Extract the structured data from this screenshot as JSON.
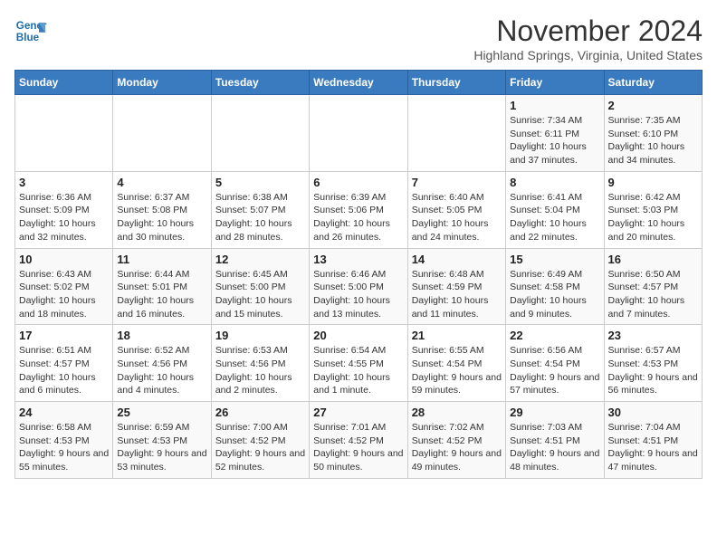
{
  "header": {
    "logo_line1": "General",
    "logo_line2": "Blue",
    "month": "November 2024",
    "location": "Highland Springs, Virginia, United States"
  },
  "days_of_week": [
    "Sunday",
    "Monday",
    "Tuesday",
    "Wednesday",
    "Thursday",
    "Friday",
    "Saturday"
  ],
  "weeks": [
    [
      {
        "day": "",
        "info": ""
      },
      {
        "day": "",
        "info": ""
      },
      {
        "day": "",
        "info": ""
      },
      {
        "day": "",
        "info": ""
      },
      {
        "day": "",
        "info": ""
      },
      {
        "day": "1",
        "info": "Sunrise: 7:34 AM\nSunset: 6:11 PM\nDaylight: 10 hours and 37 minutes."
      },
      {
        "day": "2",
        "info": "Sunrise: 7:35 AM\nSunset: 6:10 PM\nDaylight: 10 hours and 34 minutes."
      }
    ],
    [
      {
        "day": "3",
        "info": "Sunrise: 6:36 AM\nSunset: 5:09 PM\nDaylight: 10 hours and 32 minutes."
      },
      {
        "day": "4",
        "info": "Sunrise: 6:37 AM\nSunset: 5:08 PM\nDaylight: 10 hours and 30 minutes."
      },
      {
        "day": "5",
        "info": "Sunrise: 6:38 AM\nSunset: 5:07 PM\nDaylight: 10 hours and 28 minutes."
      },
      {
        "day": "6",
        "info": "Sunrise: 6:39 AM\nSunset: 5:06 PM\nDaylight: 10 hours and 26 minutes."
      },
      {
        "day": "7",
        "info": "Sunrise: 6:40 AM\nSunset: 5:05 PM\nDaylight: 10 hours and 24 minutes."
      },
      {
        "day": "8",
        "info": "Sunrise: 6:41 AM\nSunset: 5:04 PM\nDaylight: 10 hours and 22 minutes."
      },
      {
        "day": "9",
        "info": "Sunrise: 6:42 AM\nSunset: 5:03 PM\nDaylight: 10 hours and 20 minutes."
      }
    ],
    [
      {
        "day": "10",
        "info": "Sunrise: 6:43 AM\nSunset: 5:02 PM\nDaylight: 10 hours and 18 minutes."
      },
      {
        "day": "11",
        "info": "Sunrise: 6:44 AM\nSunset: 5:01 PM\nDaylight: 10 hours and 16 minutes."
      },
      {
        "day": "12",
        "info": "Sunrise: 6:45 AM\nSunset: 5:00 PM\nDaylight: 10 hours and 15 minutes."
      },
      {
        "day": "13",
        "info": "Sunrise: 6:46 AM\nSunset: 5:00 PM\nDaylight: 10 hours and 13 minutes."
      },
      {
        "day": "14",
        "info": "Sunrise: 6:48 AM\nSunset: 4:59 PM\nDaylight: 10 hours and 11 minutes."
      },
      {
        "day": "15",
        "info": "Sunrise: 6:49 AM\nSunset: 4:58 PM\nDaylight: 10 hours and 9 minutes."
      },
      {
        "day": "16",
        "info": "Sunrise: 6:50 AM\nSunset: 4:57 PM\nDaylight: 10 hours and 7 minutes."
      }
    ],
    [
      {
        "day": "17",
        "info": "Sunrise: 6:51 AM\nSunset: 4:57 PM\nDaylight: 10 hours and 6 minutes."
      },
      {
        "day": "18",
        "info": "Sunrise: 6:52 AM\nSunset: 4:56 PM\nDaylight: 10 hours and 4 minutes."
      },
      {
        "day": "19",
        "info": "Sunrise: 6:53 AM\nSunset: 4:56 PM\nDaylight: 10 hours and 2 minutes."
      },
      {
        "day": "20",
        "info": "Sunrise: 6:54 AM\nSunset: 4:55 PM\nDaylight: 10 hours and 1 minute."
      },
      {
        "day": "21",
        "info": "Sunrise: 6:55 AM\nSunset: 4:54 PM\nDaylight: 9 hours and 59 minutes."
      },
      {
        "day": "22",
        "info": "Sunrise: 6:56 AM\nSunset: 4:54 PM\nDaylight: 9 hours and 57 minutes."
      },
      {
        "day": "23",
        "info": "Sunrise: 6:57 AM\nSunset: 4:53 PM\nDaylight: 9 hours and 56 minutes."
      }
    ],
    [
      {
        "day": "24",
        "info": "Sunrise: 6:58 AM\nSunset: 4:53 PM\nDaylight: 9 hours and 55 minutes."
      },
      {
        "day": "25",
        "info": "Sunrise: 6:59 AM\nSunset: 4:53 PM\nDaylight: 9 hours and 53 minutes."
      },
      {
        "day": "26",
        "info": "Sunrise: 7:00 AM\nSunset: 4:52 PM\nDaylight: 9 hours and 52 minutes."
      },
      {
        "day": "27",
        "info": "Sunrise: 7:01 AM\nSunset: 4:52 PM\nDaylight: 9 hours and 50 minutes."
      },
      {
        "day": "28",
        "info": "Sunrise: 7:02 AM\nSunset: 4:52 PM\nDaylight: 9 hours and 49 minutes."
      },
      {
        "day": "29",
        "info": "Sunrise: 7:03 AM\nSunset: 4:51 PM\nDaylight: 9 hours and 48 minutes."
      },
      {
        "day": "30",
        "info": "Sunrise: 7:04 AM\nSunset: 4:51 PM\nDaylight: 9 hours and 47 minutes."
      }
    ]
  ]
}
